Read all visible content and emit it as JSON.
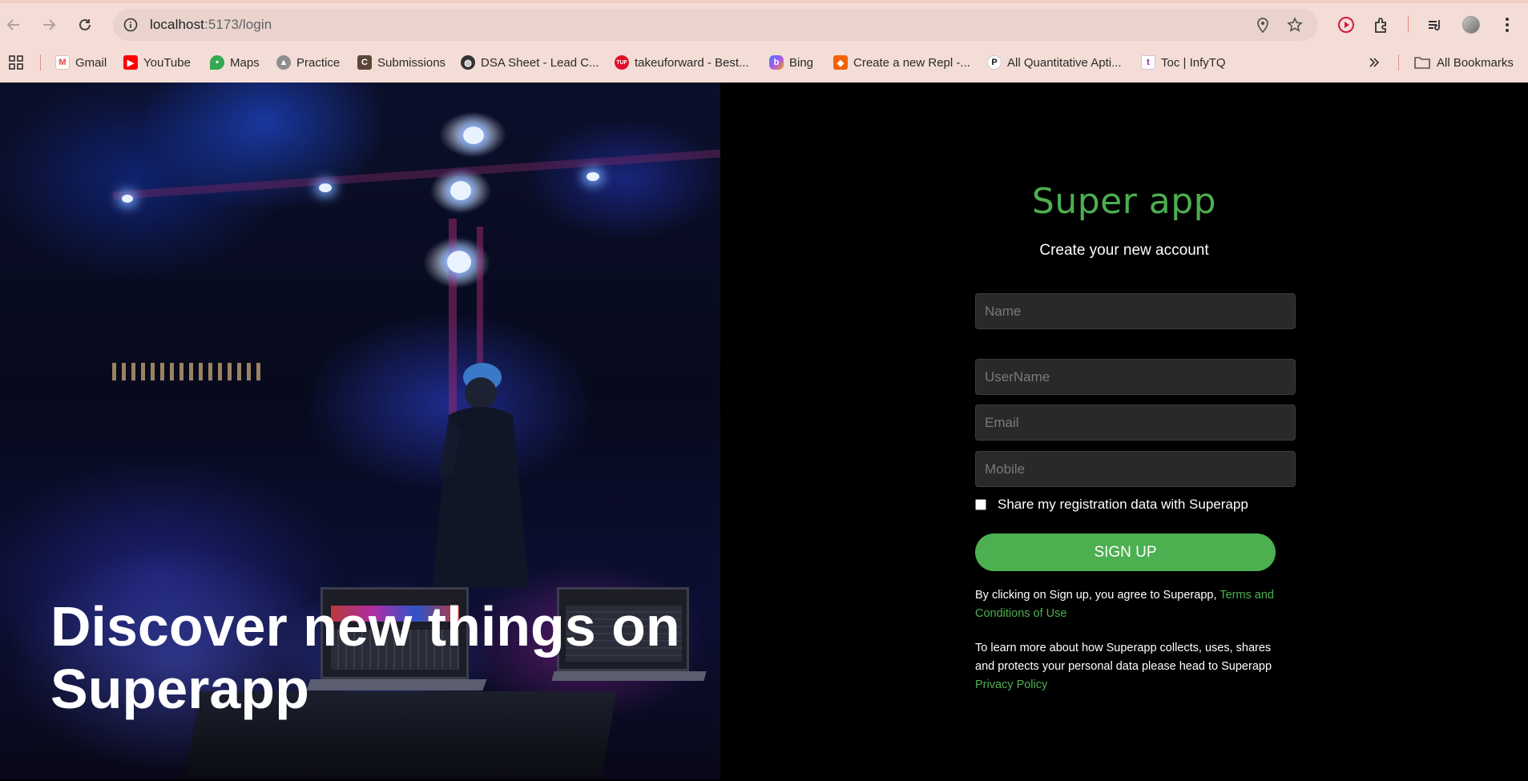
{
  "browser": {
    "url_host": "localhost",
    "url_path": ":5173/login",
    "bookmarks": [
      {
        "label": "Gmail",
        "icon": "gmail-icon",
        "color": "#ea4335"
      },
      {
        "label": "YouTube",
        "icon": "youtube-icon",
        "color": "#ff0000"
      },
      {
        "label": "Maps",
        "icon": "maps-icon",
        "color": "#34a853"
      },
      {
        "label": "Practice",
        "icon": "rocket-icon",
        "color": "#8e8e8e"
      },
      {
        "label": "Submissions",
        "icon": "codechef-icon",
        "color": "#5b4638"
      },
      {
        "label": "DSA Sheet - Lead C...",
        "icon": "globe-icon",
        "color": "#333333"
      },
      {
        "label": "takeuforward - Best...",
        "icon": "tuf-icon",
        "color": "#e0102a"
      },
      {
        "label": "Bing",
        "icon": "bing-icon",
        "color": "#3b82f6"
      },
      {
        "label": "Create a new Repl -...",
        "icon": "replit-icon",
        "color": "#f26207"
      },
      {
        "label": "All Quantitative Apti...",
        "icon": "p-icon",
        "color": "#111111"
      },
      {
        "label": "Toc | InfyTQ",
        "icon": "infytq-icon",
        "color": "#8e24aa"
      }
    ],
    "all_bookmarks_label": "All Bookmarks"
  },
  "hero": {
    "headline": "Discover new things on Superapp"
  },
  "signup": {
    "brand": "Super app",
    "subtitle": "Create your new account",
    "fields": {
      "name": "Name",
      "username": "UserName",
      "email": "Email",
      "mobile": "Mobile"
    },
    "share_label": "Share my registration data with Superapp",
    "share_checked": false,
    "button": "SIGN UP",
    "terms_text": "By clicking on Sign up, you agree to Superapp, ",
    "terms_link": "Terms and Conditions of Use",
    "privacy_text": "To learn more about how Superapp collects, uses, shares and protects your personal data please head to Superapp ",
    "privacy_link": "Privacy Policy"
  },
  "colors": {
    "accent": "#4caf50",
    "field_bg": "#292929",
    "chrome_bg": "#f4ddd6"
  }
}
